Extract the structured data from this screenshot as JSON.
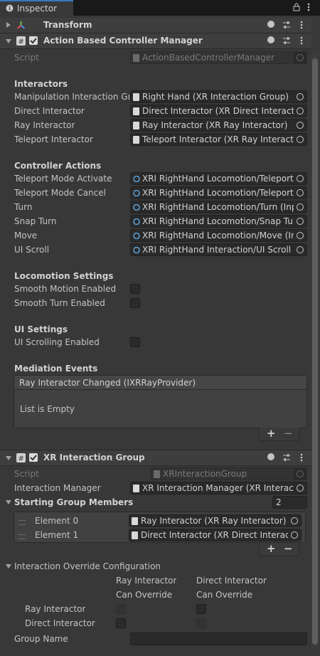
{
  "tab": {
    "label": "Inspector"
  },
  "transform": {
    "title": "Transform"
  },
  "acm": {
    "title": "Action Based Controller Manager",
    "script_label": "Script",
    "script_value": "ActionBasedControllerManager",
    "sections": {
      "interactors": "Interactors",
      "controller_actions": "Controller Actions",
      "locomotion": "Locomotion Settings",
      "ui": "UI Settings",
      "mediation": "Mediation Events"
    },
    "interactors": [
      {
        "label": "Manipulation Interaction Grou",
        "value": "Right Hand (XR Interaction Group)"
      },
      {
        "label": "Direct Interactor",
        "value": "Direct Interactor (XR Direct Interactor)"
      },
      {
        "label": "Ray Interactor",
        "value": "Ray Interactor (XR Ray Interactor)"
      },
      {
        "label": "Teleport Interactor",
        "value": "Teleport Interactor (XR Ray Interactor)"
      }
    ],
    "actions": [
      {
        "label": "Teleport Mode Activate",
        "value": "XRI RightHand Locomotion/Teleport M"
      },
      {
        "label": "Teleport Mode Cancel",
        "value": "XRI RightHand Locomotion/Teleport M"
      },
      {
        "label": "Turn",
        "value": "XRI RightHand Locomotion/Turn (Input"
      },
      {
        "label": "Snap Turn",
        "value": "XRI RightHand Locomotion/Snap Turn"
      },
      {
        "label": "Move",
        "value": "XRI RightHand Locomotion/Move (Inpu"
      },
      {
        "label": "UI Scroll",
        "value": "XRI RightHand Interaction/UI Scroll (Inp"
      }
    ],
    "locomotion": [
      {
        "label": "Smooth Motion Enabled",
        "checked": false
      },
      {
        "label": "Smooth Turn Enabled",
        "checked": false
      }
    ],
    "ui_settings": [
      {
        "label": "UI Scrolling Enabled",
        "checked": false
      }
    ],
    "mediation": {
      "event": "Ray Interactor Changed (IXRRayProvider)",
      "empty": "List is Empty",
      "add": "+",
      "remove": "−"
    }
  },
  "xig": {
    "title": "XR Interaction Group",
    "script_label": "Script",
    "script_value": "XRInteractionGroup",
    "manager_label": "Interaction Manager",
    "manager_value": "XR Interaction Manager (XR Interactio",
    "members_label": "Starting Group Members",
    "members_count": "2",
    "members": [
      {
        "label": "Element 0",
        "value": "Ray Interactor (XR Ray Interactor)"
      },
      {
        "label": "Element 1",
        "value": "Direct Interactor (XR Direct Interactor"
      }
    ],
    "add": "+",
    "remove": "−",
    "override_label": "Interaction Override Configuration",
    "col1_a": "Ray Interactor",
    "col1_b": "Can Override",
    "col2_a": "Direct Interactor",
    "col2_b": "Can Override",
    "rows": [
      {
        "label": "Ray Interactor"
      },
      {
        "label": "Direct Interactor"
      }
    ],
    "group_name_label": "Group Name",
    "group_name_value": ""
  },
  "colors": {
    "accent": "#3a79bb",
    "background": "#383838",
    "field": "#2a2a2a"
  }
}
